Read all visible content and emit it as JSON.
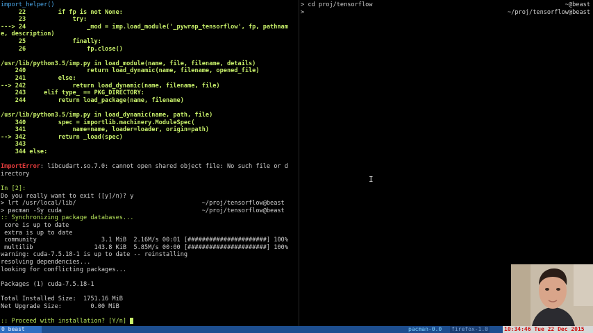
{
  "left_pane": {
    "lines": [
      {
        "text": "import_helper()",
        "cls": "t-cyan"
      },
      {
        "text": "     22         if fp is not None:",
        "cls": "t-green-b"
      },
      {
        "text": "     23             try:",
        "cls": "t-green-b"
      },
      {
        "text": "---> 24                 _mod = imp.load_module('_pywrap_tensorflow', fp, pathnam",
        "cls": "t-green-b"
      },
      {
        "text": "e, description)",
        "cls": "t-green-b"
      },
      {
        "text": "     25             finally:",
        "cls": "t-green-b"
      },
      {
        "text": "     26                 fp.close()",
        "cls": "t-green-b"
      },
      {
        "text": "",
        "cls": "t-default"
      },
      {
        "text": "/usr/lib/python3.5/imp.py in load_module(name, file, filename, details)",
        "cls": "t-green-b"
      },
      {
        "text": "    240                 return load_dynamic(name, filename, opened_file)",
        "cls": "t-green-b"
      },
      {
        "text": "    241         else:",
        "cls": "t-green-b"
      },
      {
        "text": "--> 242             return load_dynamic(name, filename, file)",
        "cls": "t-green-b"
      },
      {
        "text": "    243     elif type_ == PKG_DIRECTORY:",
        "cls": "t-green-b"
      },
      {
        "text": "    244         return load_package(name, filename)",
        "cls": "t-green-b"
      },
      {
        "text": "",
        "cls": "t-default"
      },
      {
        "text": "/usr/lib/python3.5/imp.py in load_dynamic(name, path, file)",
        "cls": "t-green-b"
      },
      {
        "text": "    340         spec = importlib.machinery.ModuleSpec(",
        "cls": "t-green-b"
      },
      {
        "text": "    341             name=name, loader=loader, origin=path)",
        "cls": "t-green-b"
      },
      {
        "text": "--> 342         return _load(spec)",
        "cls": "t-green-b"
      },
      {
        "text": "    343",
        "cls": "t-green-b"
      },
      {
        "text": "    344 else:",
        "cls": "t-green-b"
      },
      {
        "text": "",
        "cls": "t-default"
      },
      {
        "text": "ImportError: libcudart.so.7.0: cannot open shared object file: No such file or d",
        "cls": "t-default"
      },
      {
        "text": "irectory",
        "cls": "t-default"
      },
      {
        "text": "",
        "cls": "t-default"
      },
      {
        "text": "In [2]:",
        "cls": "t-green"
      },
      {
        "text": "Do you really want to exit ([y]/n)? y",
        "cls": "t-default"
      },
      {
        "text": "> lrt /usr/local/lib/                                   ~/proj/tensorflow@beast",
        "cls": "t-default"
      },
      {
        "text": "> pacman -Sy cuda                                       ~/proj/tensorflow@beast",
        "cls": "t-default"
      },
      {
        "text": ":: Synchronizing package databases...",
        "cls": "t-green"
      },
      {
        "text": " core is up to date",
        "cls": "t-default"
      },
      {
        "text": " extra is up to date",
        "cls": "t-default"
      },
      {
        "text": " community                  3.1 MiB  2.16M/s 00:01 [######################] 100%",
        "cls": "t-default"
      },
      {
        "text": " multilib                 143.8 KiB  5.85M/s 00:00 [######################] 100%",
        "cls": "t-default"
      },
      {
        "text": "warning: cuda-7.5.18-1 is up to date -- reinstalling",
        "cls": "t-default"
      },
      {
        "text": "resolving dependencies...",
        "cls": "t-default"
      },
      {
        "text": "looking for conflicting packages...",
        "cls": "t-default"
      },
      {
        "text": "",
        "cls": "t-default"
      },
      {
        "text": "Packages (1) cuda-7.5.18-1",
        "cls": "t-default"
      },
      {
        "text": "",
        "cls": "t-default"
      },
      {
        "text": "Total Installed Size:  1751.16 MiB",
        "cls": "t-default"
      },
      {
        "text": "Net Upgrade Size:        0.00 MiB",
        "cls": "t-default"
      },
      {
        "text": "",
        "cls": "t-default"
      },
      {
        "text": ":: Proceed with installation? [Y/n] ",
        "cls": "t-green",
        "cursor": true
      }
    ]
  },
  "right_pane": {
    "lines": [
      {
        "text": "> cd proj/tensorflow",
        "right": "~@beast"
      },
      {
        "text": ">",
        "right": "~/proj/tensorflow@beast"
      }
    ]
  },
  "statusbar": {
    "workspace": "0 beast",
    "pacman": "pacman-0.0",
    "firefox": "firefox-1.0",
    "clock": "10:34:46 Tue 22 Dec 2015"
  },
  "colors": {
    "background": "#000000",
    "statusbar": "#1d4e8f",
    "clock_bg": "#d8d8d8",
    "clock_fg": "#d01010"
  },
  "icons": {
    "text_cursor": "i-beam-icon"
  }
}
